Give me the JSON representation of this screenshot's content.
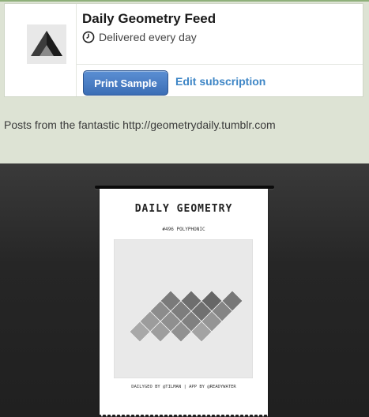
{
  "publication": {
    "title": "Daily Geometry Feed",
    "schedule": "Delivered every day",
    "schedule_icon": "clock-icon",
    "logo_icon": "triangle-logo-icon"
  },
  "actions": {
    "print_sample": "Print Sample",
    "edit_subscription": "Edit subscription"
  },
  "description": "Posts from the fantastic http://geometrydaily.tumblr.com",
  "receipt": {
    "title": "DAILY GEOMETRY",
    "issue": "#496 POLYPHONIC",
    "credit": "DAILYGEO BY @TILMAN | APP BY @READYWATER"
  },
  "colors": {
    "accent_button": "#3b6eb6",
    "link": "#3e86c6",
    "page_background": "#dde3d4"
  }
}
